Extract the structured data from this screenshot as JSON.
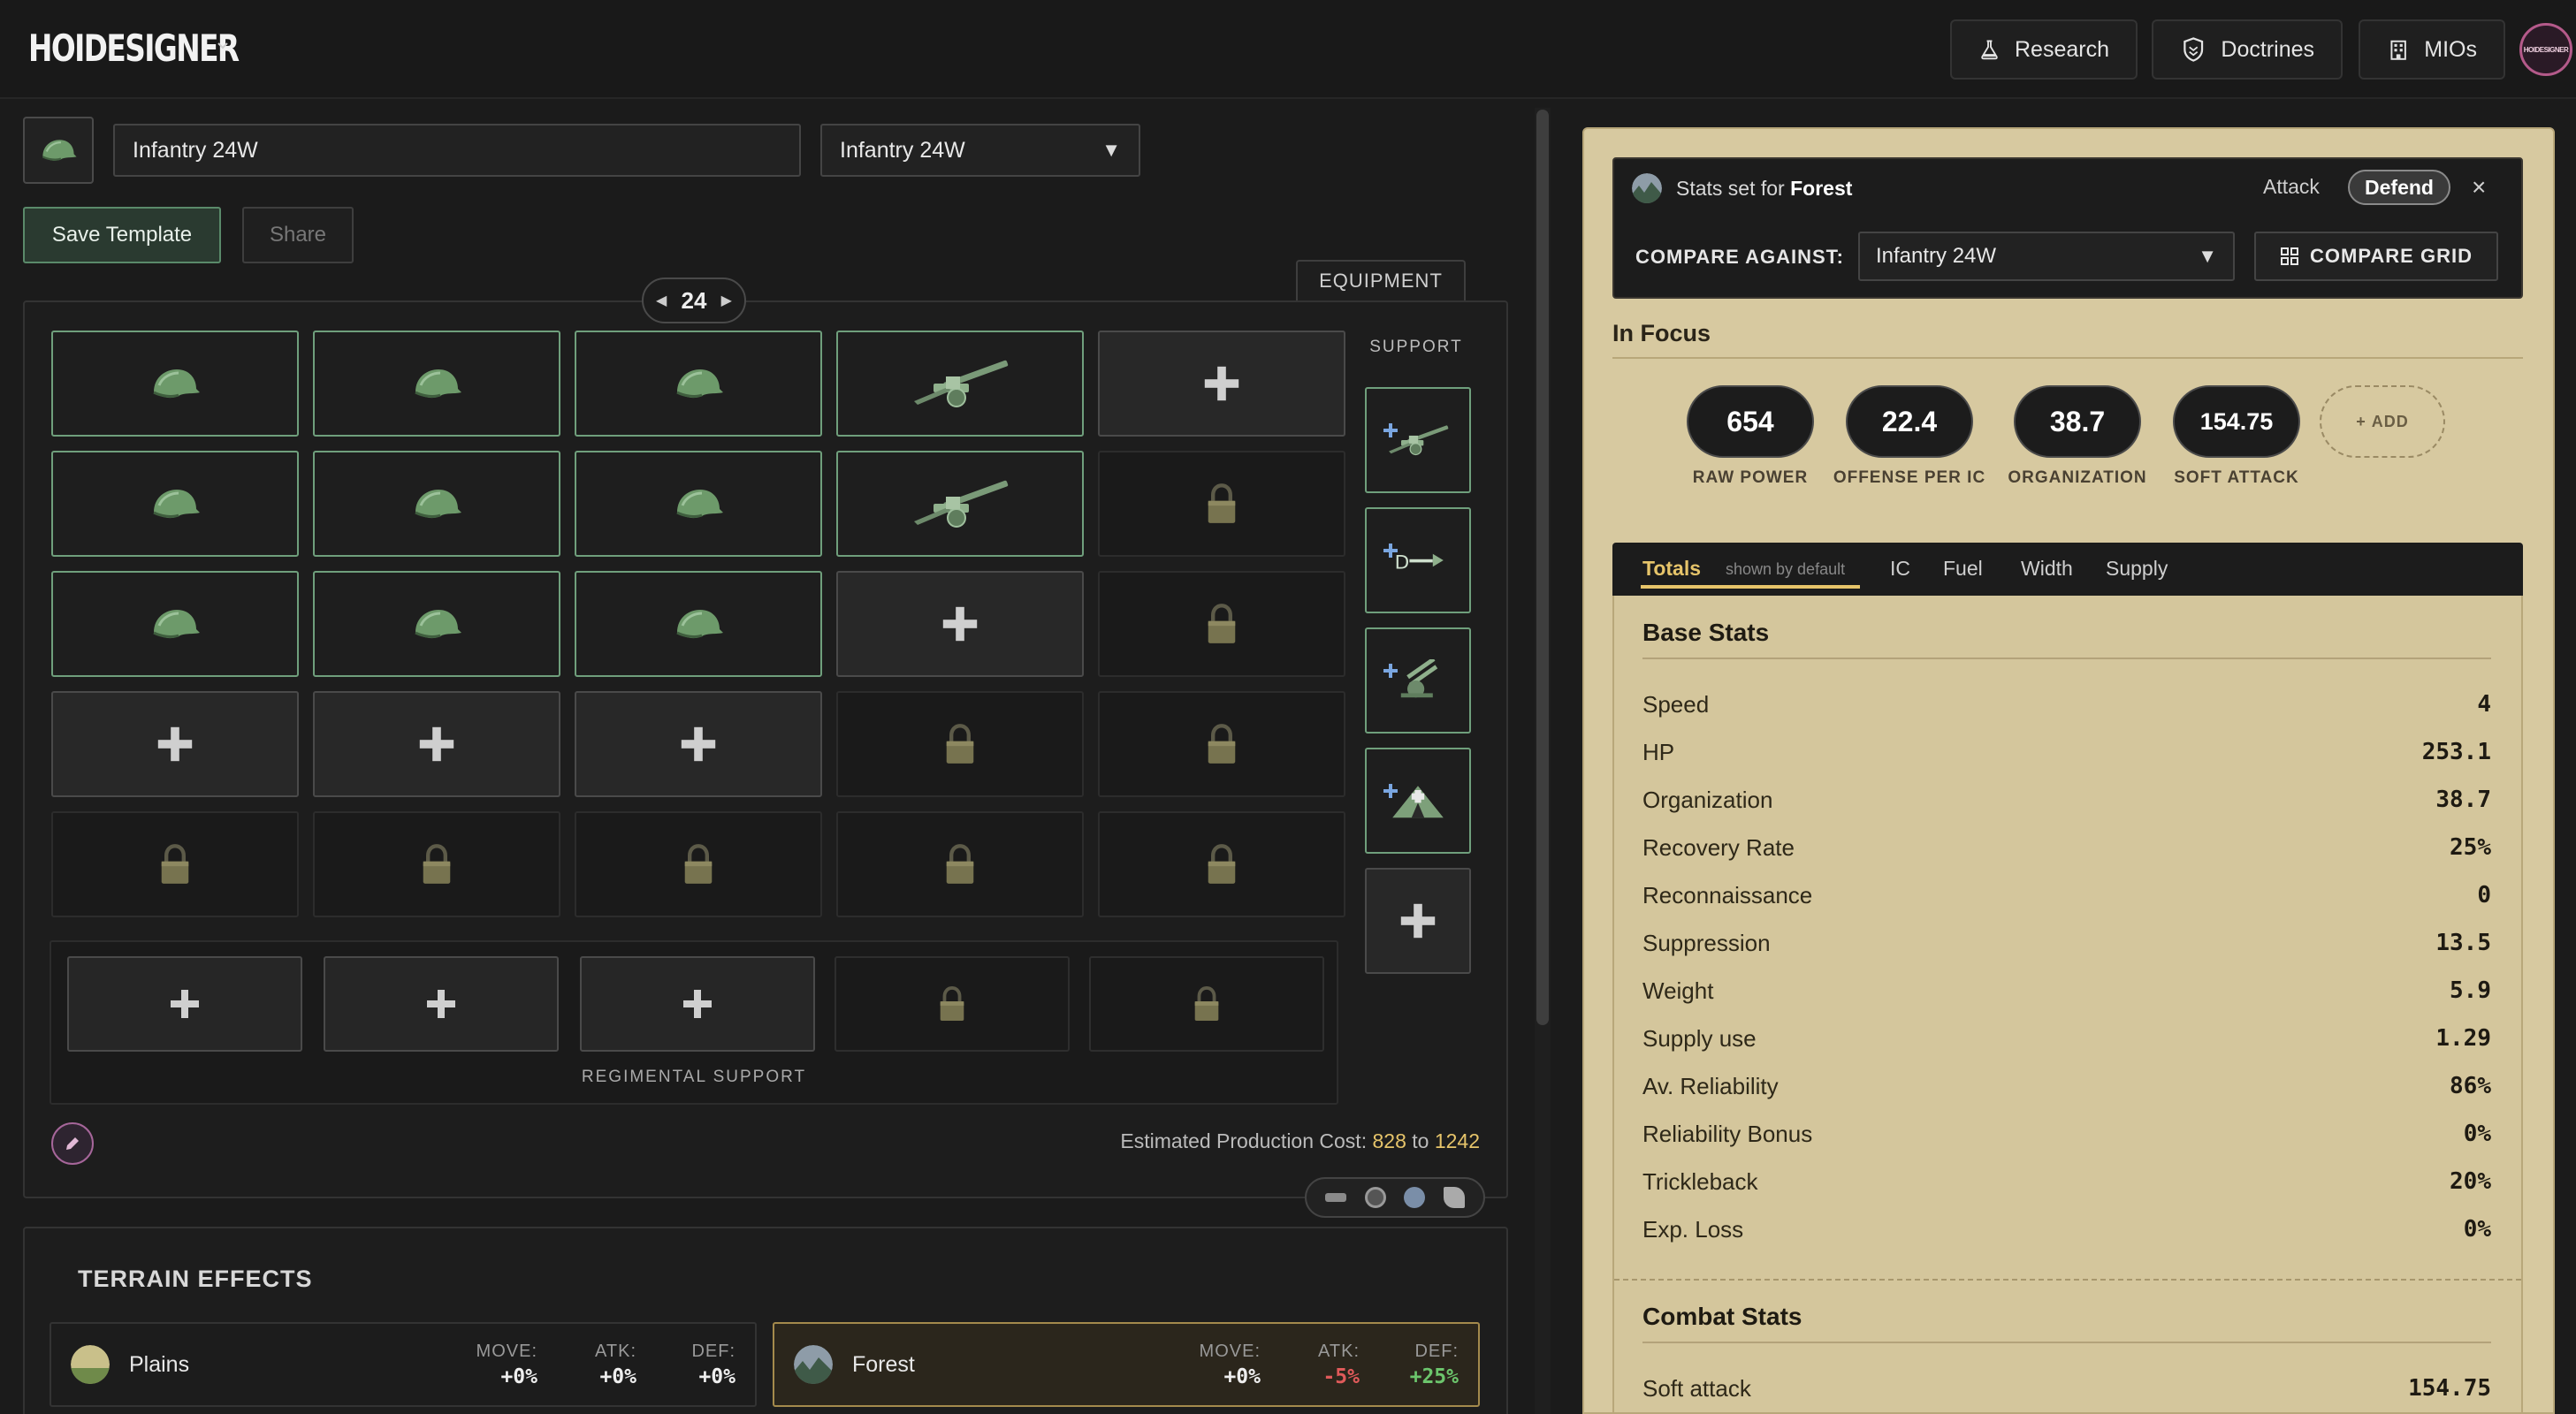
{
  "app": {
    "logo": "HOIDESIGNER",
    "avatar_text": "HOIDESIGNER"
  },
  "nav": {
    "research": "Research",
    "doctrines": "Doctrines",
    "mios": "MIOs"
  },
  "template": {
    "name_value": "Infantry 24W",
    "selected": "Infantry 24W",
    "save_label": "Save Template",
    "share_label": "Share",
    "equipment_tab": "EQUIPMENT",
    "combat_width": "24",
    "support_label": "SUPPORT",
    "regimental_label": "REGIMENTAL SUPPORT"
  },
  "grid": {
    "rows": [
      [
        "infantry",
        "infantry",
        "infantry",
        "artillery",
        "empty"
      ],
      [
        "infantry",
        "infantry",
        "infantry",
        "artillery",
        "locked"
      ],
      [
        "infantry",
        "infantry",
        "infantry",
        "empty",
        "locked"
      ],
      [
        "empty",
        "empty",
        "empty",
        "locked",
        "locked"
      ],
      [
        "locked",
        "locked",
        "locked",
        "locked",
        "locked"
      ]
    ],
    "support": [
      "support-artillery",
      "support-engineer",
      "support-anti-air",
      "support-field-hospital",
      "empty"
    ],
    "regimental": [
      "empty",
      "empty",
      "empty",
      "locked",
      "locked"
    ]
  },
  "production": {
    "prefix": "Estimated Production Cost:",
    "min": "828",
    "sep": "to",
    "max": "1242"
  },
  "terrain": {
    "title": "TERRAIN EFFECTS",
    "cards": [
      {
        "name": "Plains",
        "move_label": "MOVE:",
        "move": "+0%",
        "atk_label": "ATK:",
        "atk": "+0%",
        "def_label": "DEF:",
        "def": "+0%"
      },
      {
        "name": "Forest",
        "move_label": "MOVE:",
        "move": "+0%",
        "atk_label": "ATK:",
        "atk": "-5%",
        "def_label": "DEF:",
        "def": "+25%"
      }
    ]
  },
  "stats": {
    "set_prefix": "Stats set for",
    "set_terrain": "Forest",
    "attack_label": "Attack",
    "defend_label": "Defend",
    "close": "×",
    "compare_label": "COMPARE AGAINST:",
    "compare_value": "Infantry 24W",
    "compare_grid": "COMPARE GRID",
    "in_focus": "In Focus",
    "focus": [
      {
        "value": "654",
        "label": "RAW POWER"
      },
      {
        "value": "22.4",
        "label": "OFFENSE PER IC"
      },
      {
        "value": "38.7",
        "label": "ORGANIZATION"
      },
      {
        "value": "154.75",
        "label": "SOFT ATTACK"
      }
    ],
    "add_label": "ADD",
    "tabs": {
      "totals": "Totals",
      "totals_note": "shown by default",
      "ic": "IC",
      "fuel": "Fuel",
      "width": "Width",
      "supply": "Supply"
    },
    "base_title": "Base Stats",
    "base": [
      {
        "label": "Speed",
        "value": "4"
      },
      {
        "label": "HP",
        "value": "253.1"
      },
      {
        "label": "Organization",
        "value": "38.7"
      },
      {
        "label": "Recovery Rate",
        "value": "25%"
      },
      {
        "label": "Reconnaissance",
        "value": "0"
      },
      {
        "label": "Suppression",
        "value": "13.5"
      },
      {
        "label": "Weight",
        "value": "5.9"
      },
      {
        "label": "Supply use",
        "value": "1.29"
      },
      {
        "label": "Av. Reliability",
        "value": "86%"
      },
      {
        "label": "Reliability Bonus",
        "value": "0%"
      },
      {
        "label": "Trickleback",
        "value": "20%"
      },
      {
        "label": "Exp. Loss",
        "value": "0%"
      }
    ],
    "combat_title": "Combat Stats",
    "combat": [
      {
        "label": "Soft attack",
        "value": "154.75"
      }
    ]
  },
  "colors": {
    "accent_gold": "#e6c46a",
    "filled_border": "#6f9f7c",
    "panel_tan": "#d7c9a0",
    "negative": "#e05a5a",
    "positive": "#6cc56c"
  }
}
